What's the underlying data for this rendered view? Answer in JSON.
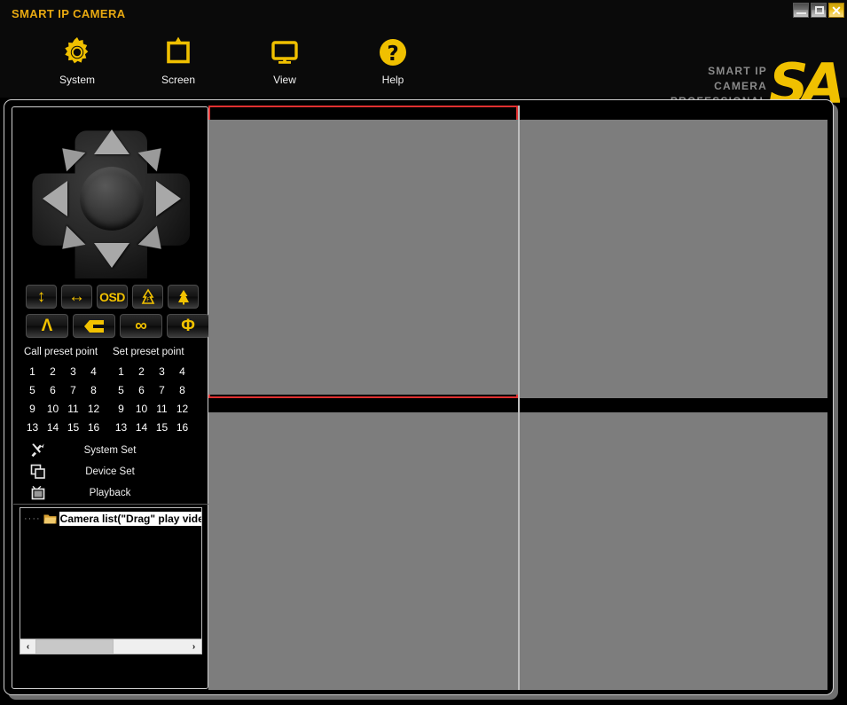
{
  "window": {
    "title": "SMART IP CAMERA",
    "controls": [
      {
        "name": "minimize",
        "glyph": "_"
      },
      {
        "name": "maximize",
        "glyph": "□"
      },
      {
        "name": "close",
        "glyph": "✕"
      }
    ]
  },
  "brand": {
    "line1": "SMART IP CAMERA",
    "line2": "PROFESSIONAL",
    "mark": "SA"
  },
  "toolbar": {
    "items": [
      {
        "label": "System",
        "icon": "gear-icon"
      },
      {
        "label": "Screen",
        "icon": "screen-icon"
      },
      {
        "label": "View",
        "icon": "monitor-icon"
      },
      {
        "label": "Help",
        "icon": "question-icon"
      }
    ]
  },
  "ptz": {
    "joystick": {
      "name": "ptz-joystick",
      "directions": [
        "up",
        "up-right",
        "right",
        "down-right",
        "down",
        "down-left",
        "left",
        "up-left"
      ],
      "center": "ptz-center-hub"
    },
    "buttons_row1": [
      {
        "name": "flip-vertical-button",
        "glyph": "↕"
      },
      {
        "name": "mirror-horizontal-button",
        "glyph": "↔"
      },
      {
        "name": "osd-button",
        "glyph": "OSD"
      },
      {
        "name": "iris-tree-button",
        "glyph": "♠"
      },
      {
        "name": "zoom-tree-button",
        "glyph": "🌲"
      }
    ],
    "buttons_row2": [
      {
        "name": "lambda-button",
        "glyph": "Λ"
      },
      {
        "name": "wedge-button",
        "glyph": "◄"
      },
      {
        "name": "infinity-button",
        "glyph": "∞"
      },
      {
        "name": "phi-button",
        "glyph": "Φ"
      }
    ]
  },
  "presets": {
    "call_label": "Call preset point",
    "set_label": "Set preset point",
    "numbers": [
      [
        "1",
        "2",
        "3",
        "4"
      ],
      [
        "5",
        "6",
        "7",
        "8"
      ],
      [
        "9",
        "10",
        "11",
        "12"
      ],
      [
        "13",
        "14",
        "15",
        "16"
      ]
    ]
  },
  "menu": {
    "items": [
      {
        "label": "System Set",
        "icon": "tools-icon"
      },
      {
        "label": "Device Set",
        "icon": "windows-stack-icon"
      },
      {
        "label": "Playback",
        "icon": "tv-icon"
      }
    ]
  },
  "camera_tree": {
    "root_label": "Camera list(\"Drag\" play video",
    "folder_icon": "folder-icon",
    "scroll_left": "‹",
    "scroll_right": "›"
  },
  "video_grid": {
    "layout": "2x2",
    "selected_pane": 1,
    "panes": [
      {
        "id": 1,
        "label": ""
      },
      {
        "id": 2,
        "label": ""
      },
      {
        "id": 3,
        "label": ""
      },
      {
        "id": 4,
        "label": ""
      }
    ]
  },
  "colors": {
    "accent": "#f0c000",
    "title": "#e8a911",
    "selection": "#e03030",
    "video_bg": "#7d7d7d",
    "panel_border": "#cfcfcf",
    "background": "#000000"
  }
}
